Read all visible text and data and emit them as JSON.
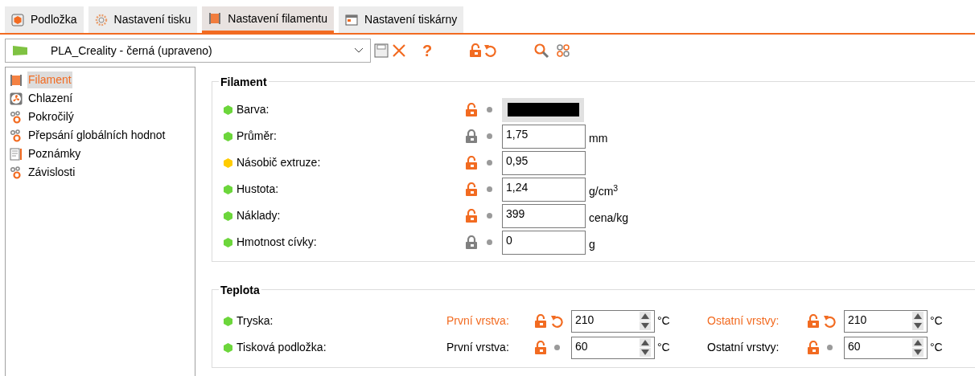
{
  "tabs": [
    {
      "label": "Podložka",
      "kind": "bed",
      "selected": false
    },
    {
      "label": "Nastavení tisku",
      "kind": "gear",
      "selected": false
    },
    {
      "label": "Nastavení filamentu",
      "kind": "spool",
      "selected": true
    },
    {
      "label": "Nastavení tiskárny",
      "kind": "printer",
      "selected": false
    }
  ],
  "profile": {
    "name": "PLA_Creality - černá (upraveno)"
  },
  "toolbar": {
    "help": "?"
  },
  "sidebar": {
    "items": [
      {
        "label": "Filament",
        "kind": "spool",
        "selected": true
      },
      {
        "label": "Chlazení",
        "kind": "fan",
        "selected": false
      },
      {
        "label": "Pokročilý",
        "kind": "wrench",
        "selected": false
      },
      {
        "label": "Přepsání globálních hodnot",
        "kind": "wrench",
        "selected": false
      },
      {
        "label": "Poznámky",
        "kind": "note",
        "selected": false
      },
      {
        "label": "Závislosti",
        "kind": "wrench",
        "selected": false
      }
    ]
  },
  "filament": {
    "title": "Filament",
    "rows": [
      {
        "kind": "color",
        "label": "Barva:",
        "color": "#6cd63b",
        "locked": false,
        "swatch": {
          "color": "#000000"
        }
      },
      {
        "kind": "number",
        "label": "Průměr:",
        "color": "#6cd63b",
        "locked": true,
        "value": "1,75",
        "unit": "mm"
      },
      {
        "kind": "number",
        "label": "Násobič extruze:",
        "color": "#ffcc00",
        "locked": false,
        "value": "0,95"
      },
      {
        "kind": "number",
        "label": "Hustota:",
        "color": "#6cd63b",
        "locked": false,
        "value": "1,24",
        "unit": "g/cm$^{3}$"
      },
      {
        "kind": "number",
        "label": "Náklady:",
        "color": "#6cd63b",
        "locked": false,
        "value": "399",
        "unit": "cena/kg"
      },
      {
        "kind": "number",
        "label": "Hmotnost cívky:",
        "color": "#6cd63b",
        "locked": true,
        "value": "0",
        "unit": "g"
      }
    ]
  },
  "temperature": {
    "title": "Teplota",
    "rows": [
      {
        "label": "Tryska:",
        "color": "#6cd63b",
        "first": {
          "label": "První vrstva:",
          "modified": true,
          "locked": false,
          "value": "210",
          "unit": "°C"
        },
        "other": {
          "label": "Ostatní vrstvy:",
          "modified": true,
          "locked": false,
          "value": "210",
          "unit": "°C"
        }
      },
      {
        "label": "Tisková podložka:",
        "color": "#6cd63b",
        "first": {
          "label": "První vrstva:",
          "modified": false,
          "locked": false,
          "value": "60",
          "unit": "°C"
        },
        "other": {
          "label": "Ostatní vrstvy:",
          "modified": false,
          "locked": false,
          "value": "60",
          "unit": "°C"
        }
      }
    ]
  }
}
